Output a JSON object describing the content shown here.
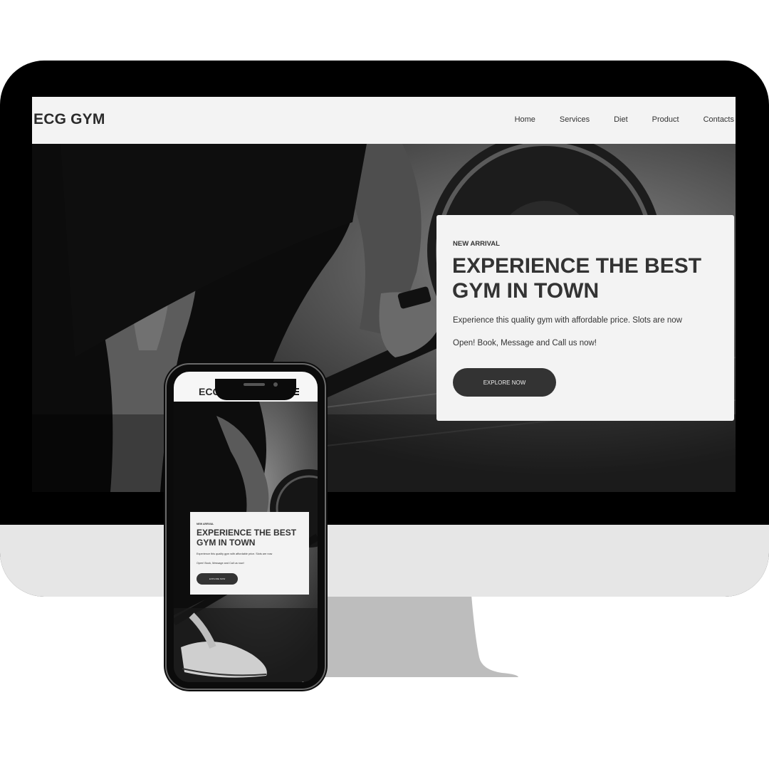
{
  "desktop": {
    "logo": "ECG GYM",
    "nav": [
      "Home",
      "Services",
      "Diet",
      "Product",
      "Contacts"
    ],
    "hero": {
      "kicker": "NEW ARRIVAL",
      "title": "EXPERIENCE THE BEST GYM IN TOWN",
      "line1": "Experience this quality gym with affordable price. Slots are now",
      "line2": "Open! Book, Message and Call us now!",
      "button": "EXPLORE NOW"
    }
  },
  "mobile": {
    "logo": "ECG GYM",
    "menu_icon": "hamburger-icon",
    "hero": {
      "kicker": "NEW ARRIVAL",
      "title": "EXPERIENCE THE BEST GYM IN TOWN",
      "line1": "Experience this quality gym with affordable price. Slots are now",
      "line2": "Open! Book, Message and Call us now!",
      "button": "EXPLORE NOW"
    }
  },
  "colors": {
    "header_bg": "#f3f3f3",
    "text_dark": "#333333",
    "button_bg": "#333333",
    "device_black": "#000000",
    "imac_chin": "#e6e6e6",
    "imac_stand": "#bdbdbd"
  }
}
